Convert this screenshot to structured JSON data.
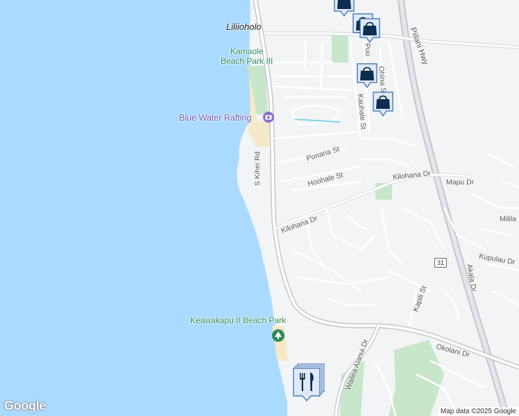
{
  "map": {
    "water_color": "#aadaff",
    "land_color": "#f3f4f6",
    "park_color": "#c8e6c9",
    "beach_color": "#f5e9c9",
    "highway_color": "#c3c7cc",
    "road_color": "#ffffff"
  },
  "labels": {
    "liliiholo": "Liliioholo",
    "kamaole_line1": "Kamaole",
    "kamaole_line2": "Beach Park III",
    "blue_water": "Blue Water Rafting",
    "keawakapu": "Keawakapu II Beach Park",
    "s_kihei_rd": "S Kihei Rd",
    "ponana_st": "Ponana St",
    "hoohale_st": "Hoohale St",
    "kilohana_dr_1": "Kilohana Dr",
    "kilohana_dr_2": "Kilohana Dr",
    "mapu_dr": "Mapu Dr",
    "milila": "Milila",
    "kupulau_dr": "Kupulau Dr",
    "akala_dr": "Akala Dr",
    "kapili_st": "Kapili St",
    "okolani_dr": "Okolani Dr",
    "wailea_alanui": "Wailea Alanui Dr",
    "pilani_hwy": "Piilani Hwy",
    "kauhale_st": "Kauhale St",
    "ohina_st": "Ohina St",
    "puu": "Puu",
    "shield_31": "31"
  },
  "markers": [
    {
      "type": "shopping",
      "icon": "shopping-bag-icon"
    },
    {
      "type": "shopping",
      "icon": "shopping-bag-icon"
    },
    {
      "type": "shopping",
      "icon": "shopping-bag-icon"
    },
    {
      "type": "shopping",
      "icon": "shopping-bag-icon"
    },
    {
      "type": "restaurant",
      "icon": "fork-knife-icon"
    }
  ],
  "branding": {
    "logo": "Google",
    "attribution": "Map data ©2025 Google"
  }
}
